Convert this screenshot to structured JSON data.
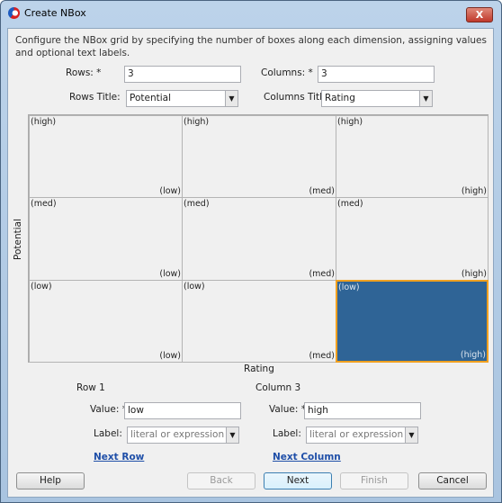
{
  "window": {
    "title": "Create NBox",
    "close_label": "X"
  },
  "description": "Configure the NBox grid by specifying the number of boxes along each dimension, assigning values and optional text labels.",
  "rows": {
    "label": "Rows: *",
    "value": "3"
  },
  "columns": {
    "label": "Columns: *",
    "value": "3"
  },
  "rows_title": {
    "label": "Rows Title:",
    "value": "Potential"
  },
  "columns_title": {
    "label": "Columns Title:",
    "value": "Rating"
  },
  "grid": {
    "row_axis_title": "Potential",
    "col_axis_title": "Rating",
    "selected_color": "#2f6496",
    "selected_border": "#f0a020",
    "cells": [
      [
        {
          "row": "(high)",
          "col": "(low)"
        },
        {
          "row": "(high)",
          "col": "(med)"
        },
        {
          "row": "(high)",
          "col": "(high)"
        }
      ],
      [
        {
          "row": "(med)",
          "col": "(low)"
        },
        {
          "row": "(med)",
          "col": "(med)"
        },
        {
          "row": "(med)",
          "col": "(high)"
        }
      ],
      [
        {
          "row": "(low)",
          "col": "(low)"
        },
        {
          "row": "(low)",
          "col": "(med)"
        },
        {
          "row": "(low)",
          "col": "(high)",
          "selected": true
        }
      ]
    ]
  },
  "row_editor": {
    "heading": "Row 1",
    "value_label": "Value: *",
    "value": "low",
    "label_label": "Label:",
    "label_placeholder": "literal or expression",
    "next": "Next Row"
  },
  "col_editor": {
    "heading": "Column 3",
    "value_label": "Value: *",
    "value": "high",
    "label_label": "Label:",
    "label_placeholder": "literal or expression",
    "next": "Next Column"
  },
  "buttons": {
    "help": "Help",
    "back": "Back",
    "next": "Next",
    "finish": "Finish",
    "cancel": "Cancel"
  }
}
